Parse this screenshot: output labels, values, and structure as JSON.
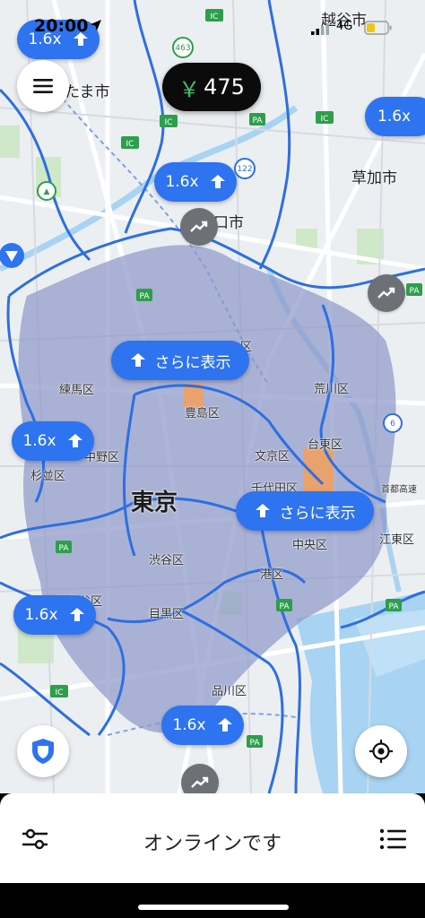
{
  "status_bar": {
    "time": "20:00",
    "network": "4G"
  },
  "earnings": {
    "currency_symbol": "￥",
    "amount": "475"
  },
  "map": {
    "places": {
      "koshigaya": "越谷市",
      "saitama": "たま市",
      "soka": "草加市",
      "kawaguchi": "口市",
      "adachi": "足",
      "nerima": "練馬区",
      "toshima": "豊島区",
      "arakawa": "荒川区",
      "nakano": "中野区",
      "suginami": "杉並区",
      "bunkyo": "文京区",
      "taito": "台東区",
      "chiyoda": "千代田区",
      "tokyo": "東京",
      "sumida_edge": "首都高速",
      "shibuya": "渋谷区",
      "chuo": "中央区",
      "koto": "江東区",
      "minato": "港区",
      "setagaya": "世田谷区",
      "meguro": "目黒区",
      "shinagawa": "品川区",
      "ku_partial": "区"
    },
    "surge_badges": [
      {
        "label": "1.6x"
      },
      {
        "label": "1.6x"
      },
      {
        "label": "1.6x"
      },
      {
        "label": "1.6x"
      },
      {
        "label": "1.6x"
      },
      {
        "label": "1.6x"
      }
    ],
    "more_badges": [
      {
        "label": "さらに表示"
      },
      {
        "label": "さらに表示"
      }
    ]
  },
  "bottom_panel": {
    "status": "オンラインです"
  },
  "colors": {
    "accent": "#2e73f0",
    "heat_overlay": "#8f98c9",
    "boundary": "#2d6fe0",
    "earnings_bg": "#0b0b0b",
    "yen": "#3fbf6a"
  }
}
